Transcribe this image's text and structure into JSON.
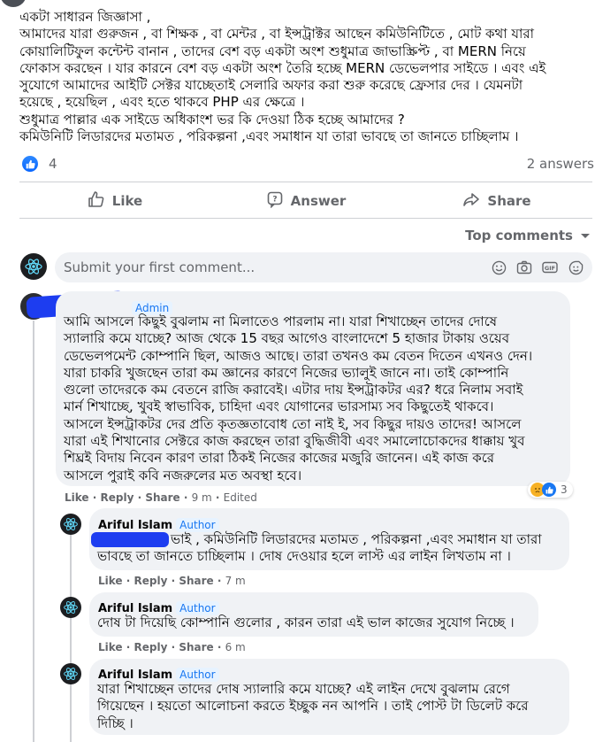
{
  "post": {
    "lines": [
      "একটা সাধারন জিজ্ঞাসা ,",
      "আমাদের যারা গুরুজন , বা শিক্ষক , বা মেন্টর , বা ইন্সট্রাক্টর আছেন কমিউনিটিতে , মোট কথা যারা",
      "কোয়ালিটিফুল কন্টেন্ট বানান , তাদের বেশ বড় একটা অংশ শুধুমাত্র জাভাস্ক্রিপ্ট , বা MERN  নিয়ে",
      "ফোকাস করছেন ।  যার কারনে বেশ বড় একটা অংশ তৈরি হচ্ছে MERN ডেভেলপার সাইডে । এবং এই",
      "সুযোগে আমাদের আইটি সেক্টর যাচ্ছেতাই সেলারি অফার করা শুরু করেছে ফ্রেসার দের । যেমনটা",
      "হয়েছে , হয়েছিল , এবং হতে থাকবে PHP এর ক্ষেত্রে ।",
      "শুধুমাত্র পাল্লার এক সাইডে অধিকাংশ ভর কি দেওয়া ঠিক হচ্ছে আমাদের ?",
      "কমিউনিটি লিডারদের মতামত , পরিকল্পনা ,এবং সমাধান যা তারা ভাবছে  তা  জানতে চাচ্ছিলাম  ।"
    ],
    "reaction_count": "4",
    "answers_count": "2 answers"
  },
  "actions": {
    "like": "Like",
    "answer": "Answer",
    "share": "Share"
  },
  "sort_label": "Top comments",
  "composer": {
    "placeholder": "Submit your first comment..."
  },
  "comments": [
    {
      "badge": "Admin",
      "lines": [
        "আমি আসলে কিছুই বুঝলাম না মিলাতেও পারলাম না। যারা শিখাচ্ছেন তাদের দোষে",
        "স্যালারি কমে যাচ্ছে? আজ থেকে 15 বছর আগেও বাংলাদেশে 5 হাজার টাকায় ওয়েব",
        "ডেভেলপমেন্ট কোম্পানি ছিল, আজও আছে। তারা তখনও কম বেতন দিতেন এখনও দেন।",
        "যারা চাকরি খুজছেন তারা কম জ্ঞানের কারণে নিজের ভ্যালুই জানে না। তাই কোম্পানি",
        "গুলো তাদেরকে কম বেতনে রাজি করাবেই। এটার দায় ইন্সট্রাকটর এর? ধরে নিলাম সবাই",
        "মার্ন শিখাচ্ছে, খুবই স্বাভাবিক, চাহিদা এবং যোগানের ভারসাম্য সব কিছুতেই থাকবে।",
        "আসলে ইন্সট্রাকটর দের প্রতি কৃতজ্ঞতাবোধ তো নাই ই, সব কিছুর দায়ও তাদের! আসলে",
        "যারা এই শিখানোর সেক্টরে কাজ করছেন তারা বুদ্ধিজীবী এবং সমালোচোকদের ধাক্কায় খুব",
        "শিঘ্রই বিদায় নিবেন কারণ তারা ঠিকই নিজের কাজের মজুরি জানেন। এই কাজ করে",
        "আসলে পুরাই কবি নজরুলের মত অবস্থা হবে।"
      ],
      "meta": {
        "like": "Like",
        "reply": "Reply",
        "share": "Share",
        "time": "9 m",
        "edited": "Edited"
      },
      "reaction_count": "3"
    },
    {
      "author": "Ariful Islam",
      "badge": "Author",
      "lines": [
        "ভাই , কমিউনিটি লিডারদের মতামত , পরিকল্পনা ,এবং সমাধান যা তারা",
        "ভাবছে তা জানতে চাচ্ছিলাম । দোষ দেওয়ার হলে লাস্ট এর লাইন লিখতাম না ।"
      ],
      "meta": {
        "like": "Like",
        "reply": "Reply",
        "share": "Share",
        "time": "7 m"
      }
    },
    {
      "author": "Ariful Islam",
      "badge": "Author",
      "lines": [
        "দোষ টা দিয়েছি কোম্পানি গুলোর , কারন তারা এই ভাল কাজের সুযোগ নিচ্ছে ।"
      ],
      "meta": {
        "like": "Like",
        "reply": "Reply",
        "share": "Share",
        "time": "6 m"
      }
    },
    {
      "author": "Ariful Islam",
      "badge": "Author",
      "lines": [
        "যারা শিখাচ্ছেন তাদের দোষ স্যালারি কমে যাচ্ছে? এই লাইন দেখে বুঝলাম রেগে",
        "গিয়েছেন । হয়তো আলোচনা করতে ইচ্ছুক নন আপনি । তাই পোস্ট টা ডিলেট করে",
        "দিচ্ছি ।"
      ]
    }
  ],
  "colors": {
    "accent": "#1877f2",
    "bubble": "#f0f2f5",
    "secondary_text": "#65676b",
    "scribble": "#1d3df0"
  },
  "icons": [
    "like-icon",
    "answer-icon",
    "share-icon",
    "chevron-down-icon",
    "emoji-icon",
    "camera-icon",
    "gif-icon",
    "sticker-icon",
    "sad-reaction-icon",
    "like-reaction-icon"
  ]
}
